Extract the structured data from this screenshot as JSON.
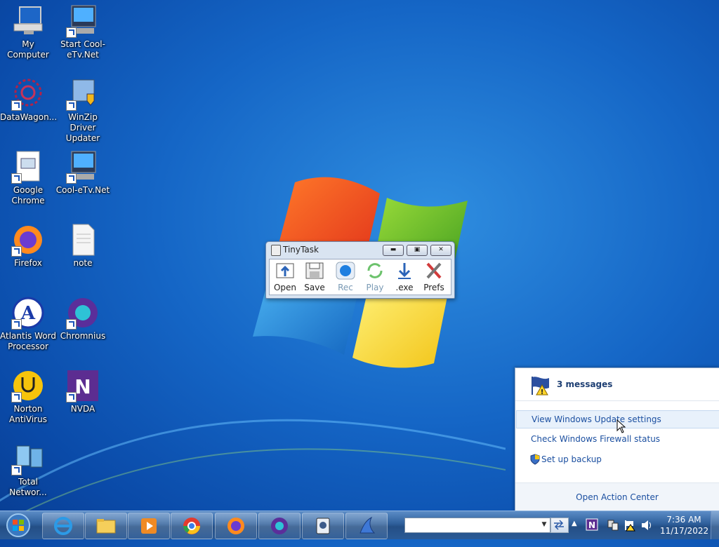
{
  "desktop": {
    "icons": [
      {
        "label": "My Computer"
      },
      {
        "label": "Start Cool-eTv.Net"
      },
      {
        "label": "DataWagon..."
      },
      {
        "label": "WinZip Driver Updater"
      },
      {
        "label": "Google Chrome"
      },
      {
        "label": "Cool-eTv.Net"
      },
      {
        "label": "Firefox"
      },
      {
        "label": "note"
      },
      {
        "label": "Atlantis Word Processor"
      },
      {
        "label": "Chromnius"
      },
      {
        "label": "Norton AntiVirus"
      },
      {
        "label": "NVDA"
      },
      {
        "label": "Total Networ..."
      }
    ]
  },
  "tinytask": {
    "title": "TinyTask",
    "buttons": {
      "minimize": "▬",
      "restore": "▣",
      "close": "✕"
    },
    "tools": [
      {
        "label": "Open"
      },
      {
        "label": "Save"
      },
      {
        "label": "Rec"
      },
      {
        "label": "Play"
      },
      {
        "label": ".exe"
      },
      {
        "label": "Prefs"
      }
    ]
  },
  "action_center": {
    "messages": "3 messages",
    "items": [
      {
        "label": "View Windows Update settings"
      },
      {
        "label": "Check Windows Firewall status"
      },
      {
        "label": "Set up backup"
      }
    ],
    "footer": "Open Action Center"
  },
  "taskbar": {
    "address_value": "",
    "dropdown": "▼",
    "tray_arrow": "▲",
    "clock_time": "7:36 AM",
    "clock_date": "11/17/2022"
  },
  "colors": {
    "link": "#1b4fa0",
    "taskbar": "#2e5f9b"
  }
}
